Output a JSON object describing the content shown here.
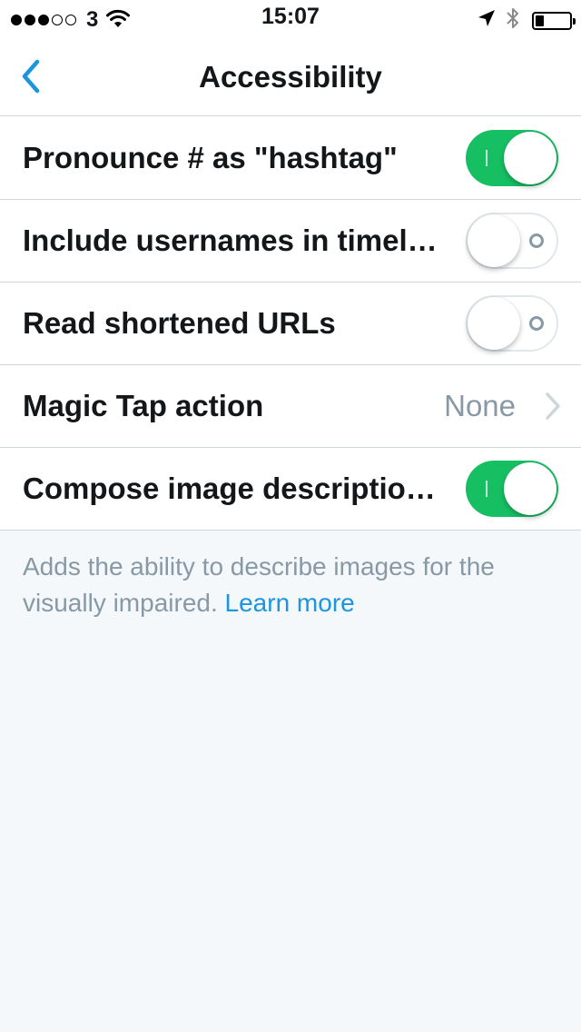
{
  "status_bar": {
    "carrier": "3",
    "time": "15:07",
    "signal_strength": 3,
    "signal_max": 5,
    "battery_level": 0.25,
    "icons": [
      "wifi-icon",
      "location-arrow-icon",
      "bluetooth-icon",
      "battery-icon"
    ]
  },
  "nav": {
    "title": "Accessibility",
    "back_icon": "chevron-left-icon"
  },
  "settings": [
    {
      "label": "Pronounce # as \"hashtag\"",
      "type": "toggle",
      "on": true
    },
    {
      "label": "Include usernames in timelines",
      "type": "toggle",
      "on": false
    },
    {
      "label": "Read shortened URLs",
      "type": "toggle",
      "on": false
    },
    {
      "label": "Magic Tap action",
      "type": "disclosure",
      "value": "None"
    },
    {
      "label": "Compose image descriptions",
      "type": "toggle",
      "on": true
    }
  ],
  "footer": {
    "text": "Adds the ability to describe images for the visually impaired.",
    "link": "Learn more"
  },
  "colors": {
    "accent": "#1b95e0",
    "toggle_on": "#17bf63",
    "separator": "#ccd6dd",
    "secondary_text": "#8899a6",
    "background": "#f5f8fa"
  }
}
